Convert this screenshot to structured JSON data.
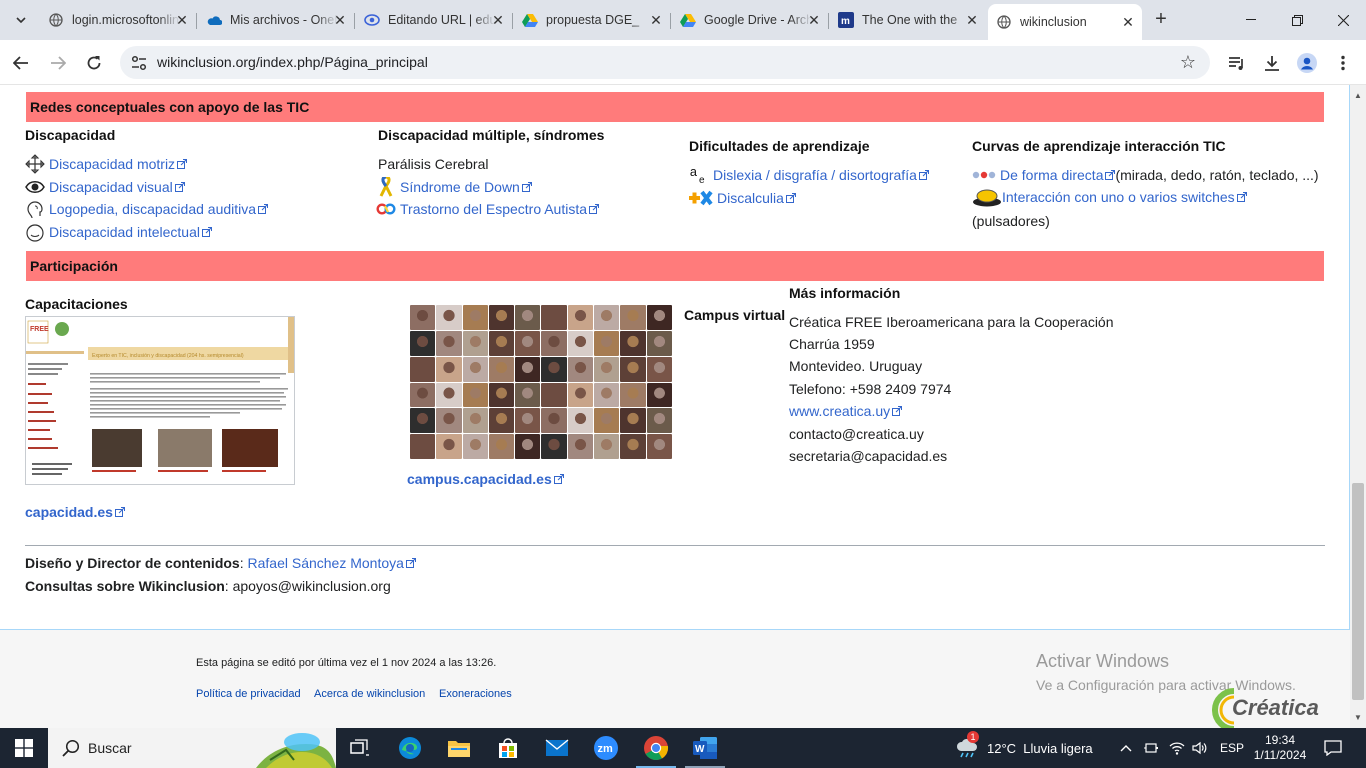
{
  "browser": {
    "tabs": [
      {
        "title": "login.microsoftonline.com",
        "icon": "globe-icon"
      },
      {
        "title": "Mis archivos - OneDrive",
        "icon": "onedrive-icon"
      },
      {
        "title": "Editando URL | edu",
        "icon": "link-icon"
      },
      {
        "title": "propuesta DGE_",
        "icon": "google-drive-icon"
      },
      {
        "title": "Google Drive - Archivos",
        "icon": "google-drive-icon"
      },
      {
        "title": "The One with the",
        "icon": "m-icon"
      },
      {
        "title": "wikinclusion",
        "icon": "globe-icon",
        "active": true
      }
    ],
    "url": "wikinclusion.org/index.php/Página_principal"
  },
  "sections": {
    "redes_title": "Redes conceptuales con apoyo de las TIC",
    "discapacidad": {
      "title": "Discapacidad",
      "items": [
        {
          "label": "Discapacidad motriz",
          "icon": "move-arrows-icon"
        },
        {
          "label": "Discapacidad visual",
          "icon": "eye-icon"
        },
        {
          "label": "Logopedia, discapacidad auditiva",
          "icon": "head-icon"
        },
        {
          "label": "Discapacidad intelectual",
          "icon": "face-icon"
        }
      ]
    },
    "multiple": {
      "title": "Discapacidad múltiple, síndromes",
      "plain": "Parálisis Cerebral",
      "items": [
        {
          "label": "Síndrome de Down",
          "icon": "ribbon-icon"
        },
        {
          "label": "Trastorno del Espectro Autista",
          "icon": "infinity-icon"
        }
      ]
    },
    "aprendizaje": {
      "title": "Dificultades de aprendizaje",
      "items": [
        {
          "label": "Dislexia / disgrafía / disortografía",
          "icon": "letters-icon"
        },
        {
          "label": "Discalculia",
          "icon": "math-icon"
        }
      ]
    },
    "curvas": {
      "title": "Curvas de aprendizaje interacción TIC",
      "item1": "De forma directa",
      "item1_suffix": " (mirada, dedo, ratón, teclado, ...)",
      "item2": "Interacción con uno o varios switches",
      "item2_suffix": "(pulsadores)"
    },
    "participacion_title": "Participación",
    "capacitaciones": {
      "title": "Capacitaciones",
      "link": "capacidad.es",
      "thumb_heading": "Experto en TIC, inclusión y discapacidad (204 hs. semipresencial)"
    },
    "campus": {
      "title": "Campus virtual",
      "link": "campus.capacidad.es"
    },
    "mas_info": {
      "title": "Más información",
      "lines": [
        "Créatica FREE Iberoamericana para la Cooperación",
        "Charrúa 1959",
        "Montevideo. Uruguay",
        "Telefono: +598 2409 7974"
      ],
      "web": "www.creatica.uy",
      "emails": [
        "contacto@creatica.uy",
        "secretaria@capacidad.es"
      ]
    },
    "credits": {
      "design_label": "Diseño y Director de contenidos",
      "design_name": "Rafael Sánchez Montoya",
      "contact_label": "Consultas sobre Wikinclusion",
      "contact_email": "apoyos@wikinclusion.org"
    }
  },
  "footer": {
    "edited": "Esta página se editó por última vez el 1 nov 2024 a las 13:26.",
    "links": [
      "Política de privacidad",
      "Acerca de wikinclusion",
      "Exoneraciones"
    ],
    "activate_title": "Activar Windows",
    "activate_sub": "Ve a Configuración para activar Windows.",
    "logo": "Créatica"
  },
  "taskbar": {
    "search": "Buscar",
    "weather": "12°C  Lluvia ligera",
    "weather_badge": "1",
    "lang": "ESP",
    "time": "19:34",
    "date": "1/11/2024"
  },
  "colors": {
    "band": "#ff7b7b",
    "link": "#3366cc",
    "taskbar": "#1c2532"
  }
}
